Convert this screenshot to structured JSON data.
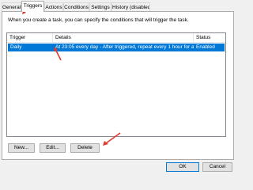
{
  "tabs": [
    {
      "label": "General"
    },
    {
      "label": "Triggers"
    },
    {
      "label": "Actions"
    },
    {
      "label": "Conditions"
    },
    {
      "label": "Settings"
    },
    {
      "label": "History (disabled)"
    }
  ],
  "description": "When you create a task, you can specify the conditions that will trigger the task.",
  "table": {
    "columns": [
      "Trigger",
      "Details",
      "Status"
    ],
    "rows": [
      {
        "trigger": "Daily",
        "details": "At 23:05 every day - After triggered, repeat every 1 hour for a dur...",
        "status": "Enabled"
      }
    ]
  },
  "buttons": {
    "new": "New...",
    "edit": "Edit...",
    "delete": "Delete",
    "ok": "OK",
    "cancel": "Cancel"
  },
  "colors": {
    "selection": "#0078d7",
    "annotation_arrow": "#e03a2e"
  }
}
